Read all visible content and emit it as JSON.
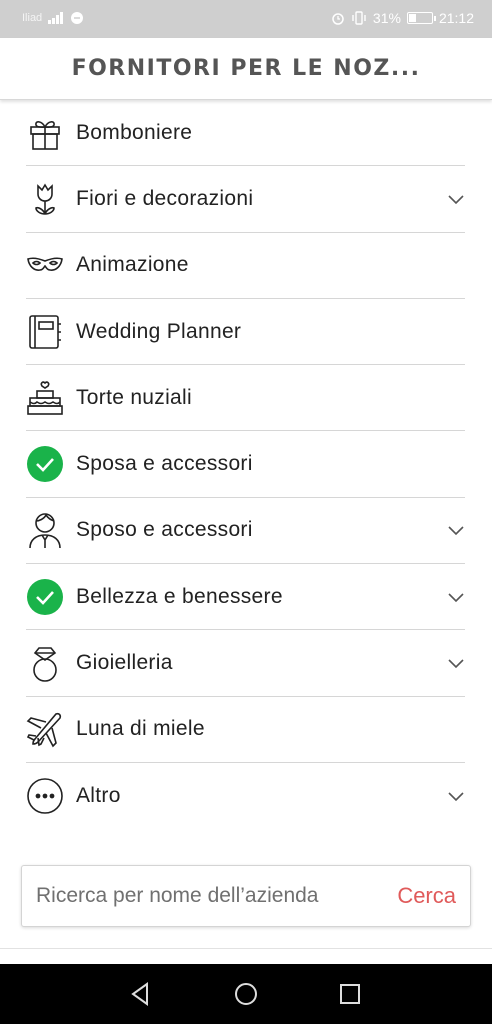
{
  "statusbar": {
    "carrier": "Iliad",
    "battery": "31%",
    "time": "21:12"
  },
  "header": {
    "title": "FORNITORI PER LE NOZ..."
  },
  "categories": [
    {
      "label": "Bomboniere",
      "icon": "gift-icon",
      "checked": false,
      "expandable": false
    },
    {
      "label": "Fiori e decorazioni",
      "icon": "tulip-icon",
      "checked": false,
      "expandable": true
    },
    {
      "label": "Animazione",
      "icon": "mask-icon",
      "checked": false,
      "expandable": false
    },
    {
      "label": "Wedding Planner",
      "icon": "planner-icon",
      "checked": false,
      "expandable": false
    },
    {
      "label": "Torte nuziali",
      "icon": "cake-icon",
      "checked": false,
      "expandable": false
    },
    {
      "label": "Sposa e accessori",
      "icon": "check-icon",
      "checked": true,
      "expandable": false
    },
    {
      "label": "Sposo e accessori",
      "icon": "groom-icon",
      "checked": false,
      "expandable": true
    },
    {
      "label": "Bellezza e benessere",
      "icon": "check-icon",
      "checked": true,
      "expandable": true
    },
    {
      "label": "Gioielleria",
      "icon": "ring-icon",
      "checked": false,
      "expandable": true
    },
    {
      "label": "Luna di miele",
      "icon": "plane-icon",
      "checked": false,
      "expandable": false
    },
    {
      "label": "Altro",
      "icon": "more-icon",
      "checked": false,
      "expandable": true
    }
  ],
  "search": {
    "placeholder": "Ricerca per nome dell’azienda",
    "value": "",
    "button_label": "Cerca"
  },
  "colors": {
    "check": "#1ab34a",
    "accent": "#e05a5a"
  }
}
